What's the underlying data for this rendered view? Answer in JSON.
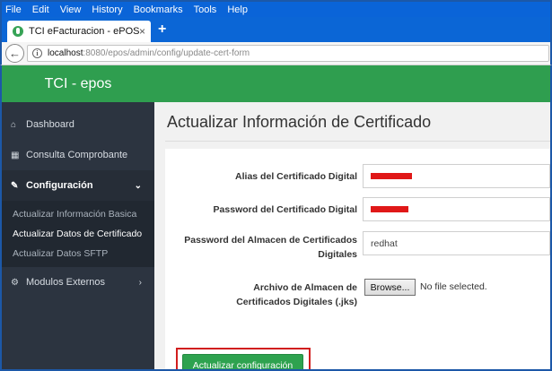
{
  "browser": {
    "menu": [
      "File",
      "Edit",
      "View",
      "History",
      "Bookmarks",
      "Tools",
      "Help"
    ],
    "tab_title": "TCI eFacturacion - ePOS",
    "tab_close": "×",
    "new_tab": "+",
    "url_host": "localhost",
    "url_rest": ":8080/epos/admin/config/update-cert-form"
  },
  "sidebar": {
    "brand": "TCI - epos",
    "items": {
      "dashboard": {
        "label": "Dashboard",
        "icon": "home-icon"
      },
      "consulta": {
        "label": "Consulta Comprobante",
        "icon": "calculator-icon"
      },
      "configuracion": {
        "label": "Configuración",
        "icon": "edit-icon"
      },
      "modulos": {
        "label": "Modulos Externos",
        "icon": "cogs-icon"
      }
    },
    "submenu": [
      "Actualizar Información Basica",
      "Actualizar Datos de Certificado",
      "Actualizar Datos SFTP"
    ]
  },
  "main": {
    "title": "Actualizar Información de Certificado",
    "form": {
      "alias_label": "Alias del Certificado Digital",
      "password_label": "Password del Certificado Digital",
      "store_password_label": "Password del Almacen de Certificados Digitales",
      "store_password_value": "redhat",
      "file_label": "Archivo de Almacen de Certificados Digitales (.jks)",
      "browse_label": "Browse...",
      "no_file": "No file selected.",
      "submit_label": "Actualizar configuración"
    }
  },
  "colors": {
    "brand_green": "#2f9e4f",
    "sidebar_bg": "#2c3440",
    "highlight_red": "#d11e1e",
    "redaction_red": "#e01818"
  }
}
